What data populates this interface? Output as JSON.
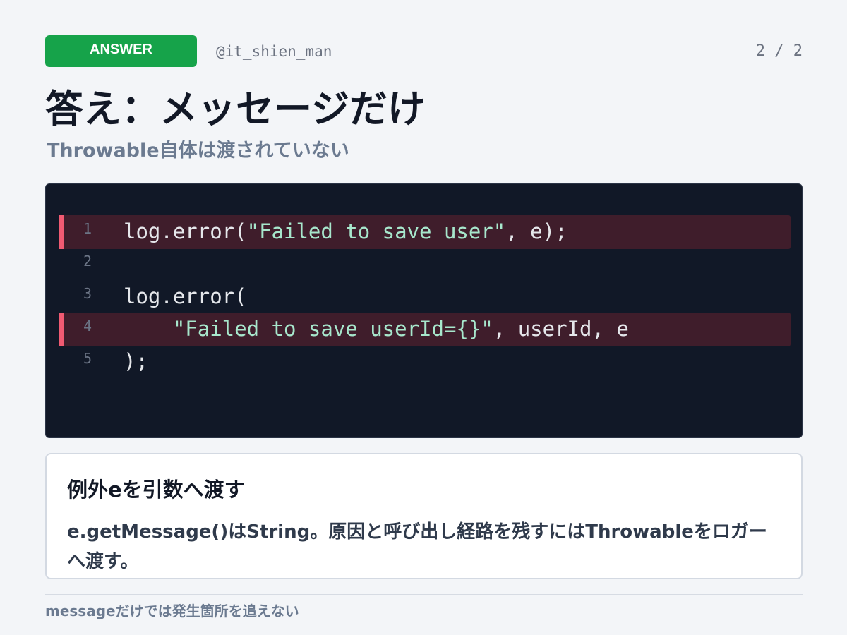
{
  "header": {
    "badge_label": "ANSWER",
    "handle": "@it_shien_man",
    "page_count": "2 / 2"
  },
  "title": "答え：メッセージだけ",
  "subtitle": "Throwable自体は渡されていない",
  "code": {
    "lines": [
      {
        "number": "1",
        "code": "log.error(",
        "string": "\"Failed to save user\"",
        "rest": ", e);",
        "highlighted": true
      },
      {
        "number": "2",
        "code": "",
        "string": "",
        "rest": "",
        "highlighted": false
      },
      {
        "number": "3",
        "code": "log.error(",
        "string": "",
        "rest": "",
        "highlighted": false
      },
      {
        "number": "4",
        "code": "    ",
        "string": "\"Failed to save userId={}\"",
        "rest": ", userId, e",
        "highlighted": true
      },
      {
        "number": "5",
        "code": ");",
        "string": "",
        "rest": "",
        "highlighted": false
      }
    ],
    "colors": {
      "background": "#111827",
      "highlight": "#3f1d2b",
      "marker": "#f05a72",
      "string": "#a7e7cc"
    }
  },
  "note": {
    "title": "例外eを引数へ渡す",
    "body": "e.getMessage()はString。原因と呼び出し経路を残すにはThrowableをロガーへ渡す。"
  },
  "footer": "messageだけでは発生箇所を追えない",
  "colors": {
    "accent": "#16a34a",
    "background": "#f3f5f8"
  }
}
